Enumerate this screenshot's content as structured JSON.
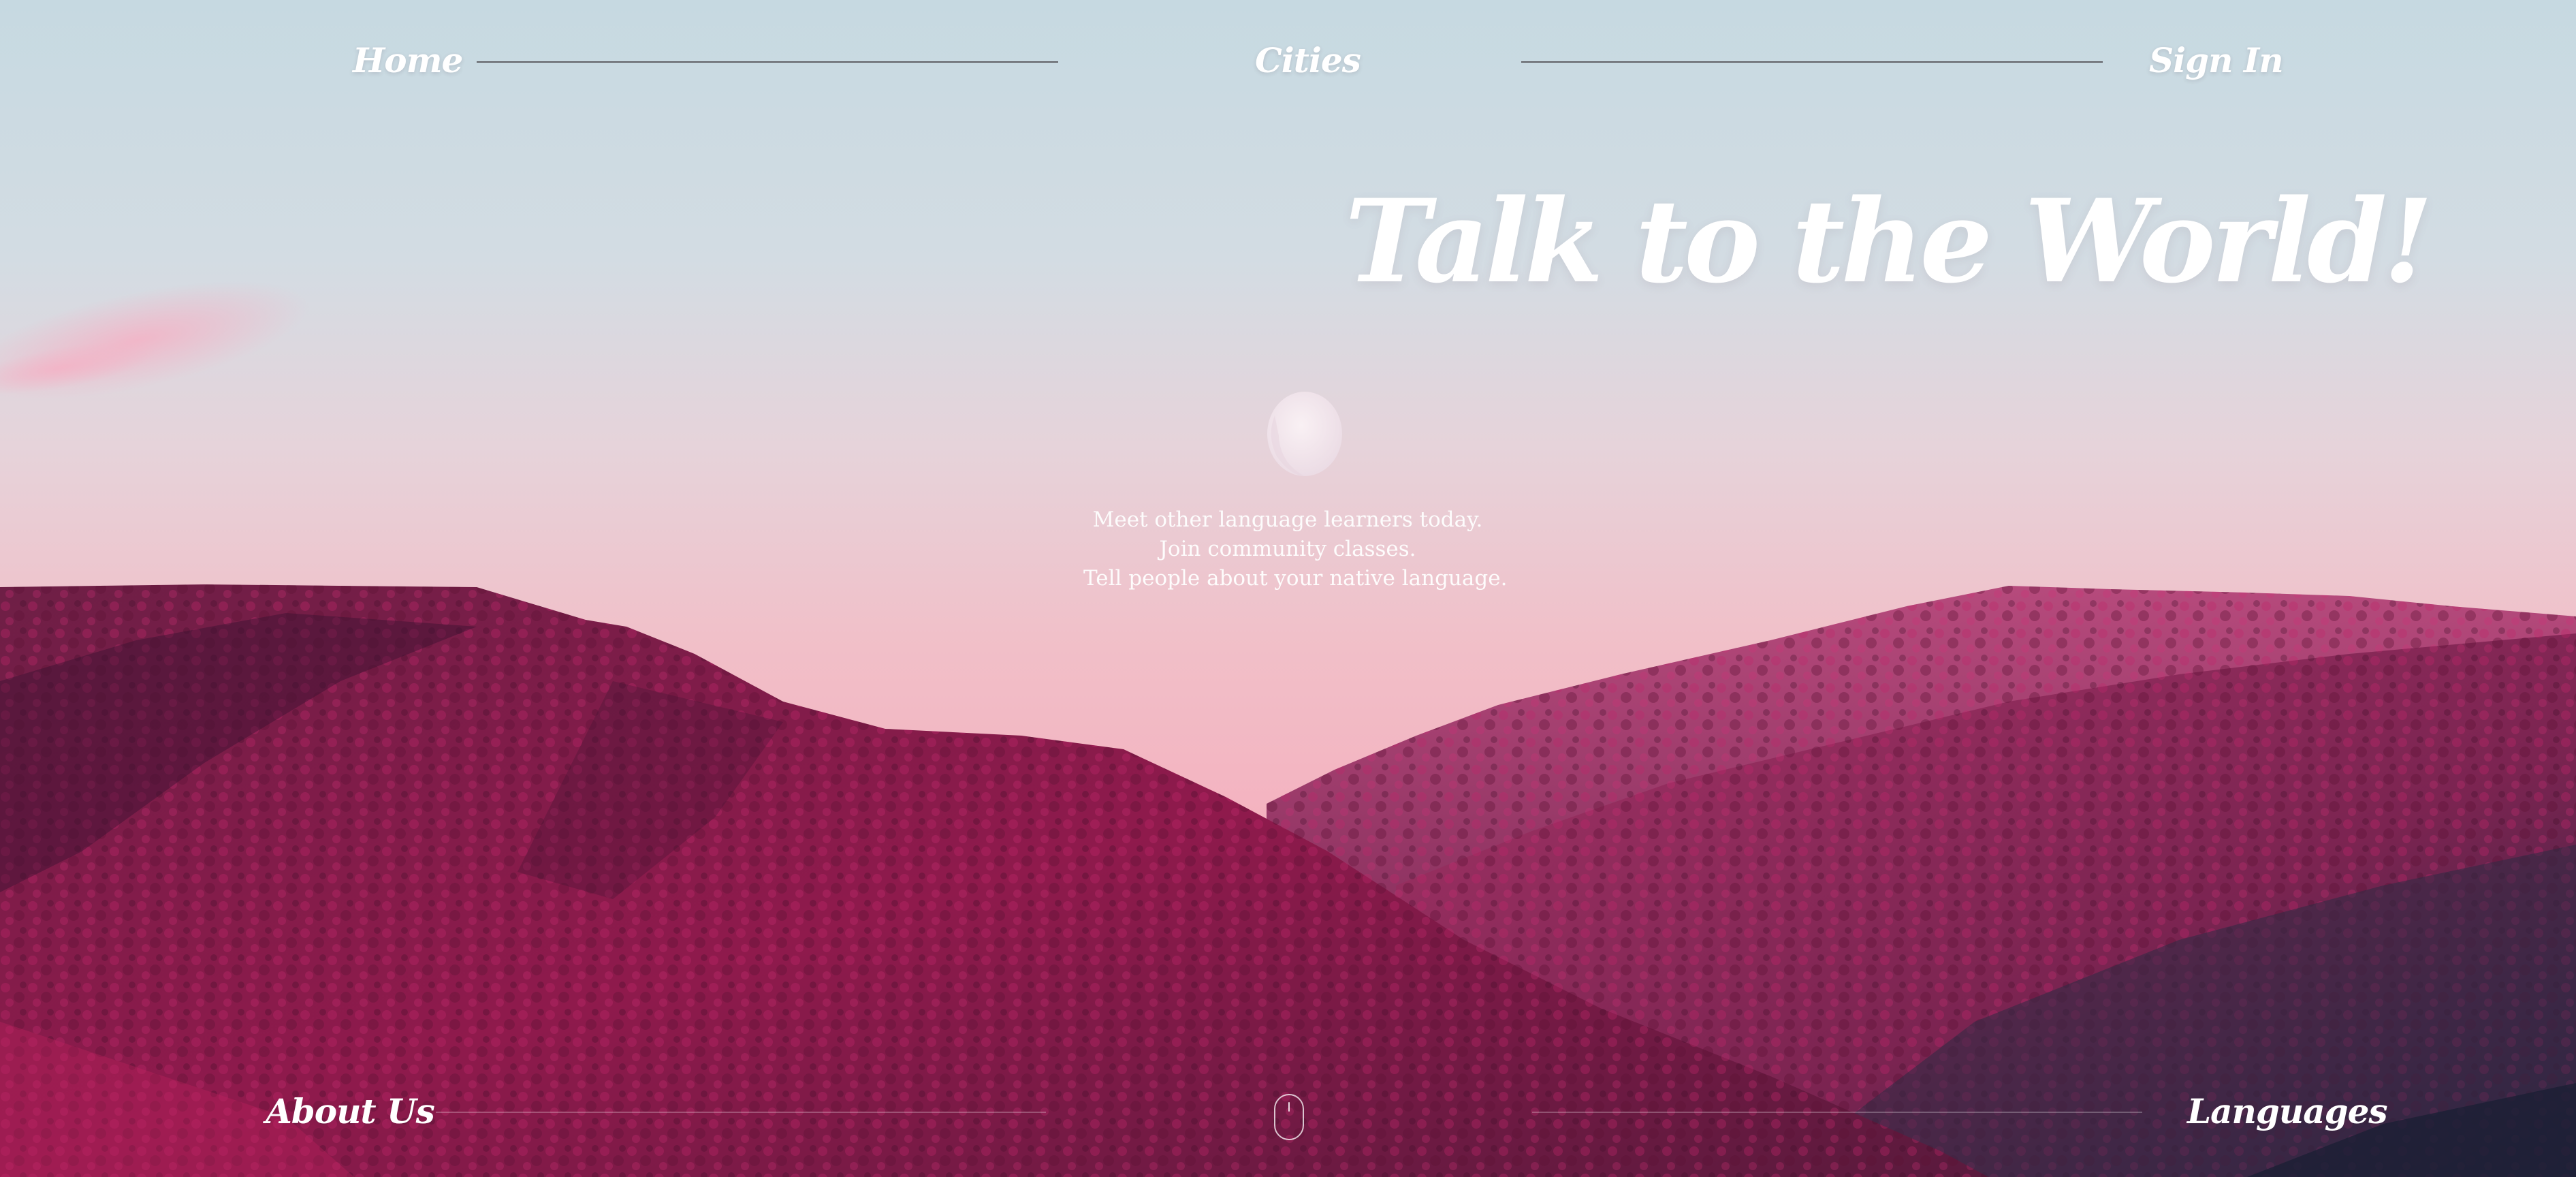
{
  "nav": {
    "home": "Home",
    "cities": "Cities",
    "sign_in": "Sign In"
  },
  "hero": {
    "title": "Talk to the World!",
    "tagline": [
      "Meet other language learners today.",
      "Join community classes.",
      "Tell people about your native language."
    ]
  },
  "footer_nav": {
    "about": "About Us",
    "languages": "Languages"
  },
  "colors": {
    "sky_top": "#c7d9e1",
    "sky_bottom": "#f2b7c3",
    "mountain_far": "#a23a6c",
    "mountain_near": "#8a1a48",
    "text": "#ffffff"
  }
}
